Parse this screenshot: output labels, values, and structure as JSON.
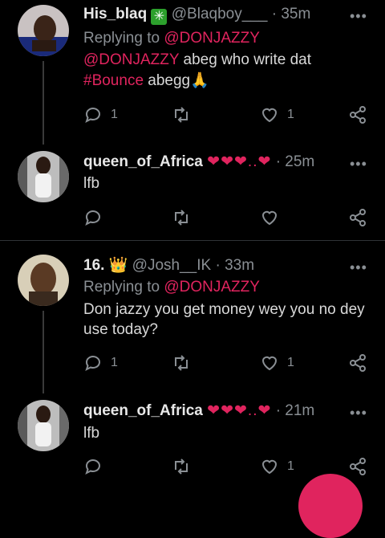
{
  "colors": {
    "accent": "#e0245e",
    "muted": "#8a8f94",
    "background": "#000000"
  },
  "tweets": [
    {
      "name": "His_blaq",
      "badge": "✳",
      "handle": "@Blaqboy___",
      "dot": "·",
      "time": "35m",
      "replying_label": "Replying to",
      "replying_to": "@DONJAZZY",
      "body_mention": "@DONJAZZY",
      "body_text1": " abeg who write dat",
      "hashtag": "#Bounce",
      "body_text2": " abegg🙏",
      "reply_count": "1",
      "retweet_count": "",
      "like_count": "1"
    },
    {
      "name": "queen_of_Africa",
      "hearts": "❤❤❤..❤",
      "dot": "·",
      "time": "25m",
      "body": "lfb",
      "reply_count": "",
      "retweet_count": "",
      "like_count": ""
    },
    {
      "name": "16.",
      "crown": "👑",
      "handle": "@Josh__IK",
      "dot": "·",
      "time": "33m",
      "replying_label": "Replying to",
      "replying_to": "@DONJAZZY",
      "body_line1": "Don jazzy you get money wey you no dey",
      "body_line2": "use today?",
      "reply_count": "1",
      "retweet_count": "",
      "like_count": "1"
    },
    {
      "name": "queen_of_Africa",
      "hearts": "❤❤❤..❤",
      "dot": "·",
      "time": "21m",
      "body": "lfb",
      "reply_count": "",
      "retweet_count": "",
      "like_count": "1"
    }
  ],
  "icons": {
    "reply": "reply-icon",
    "retweet": "retweet-icon",
    "like": "heart-icon",
    "share": "share-icon",
    "more": "more-icon"
  },
  "more_label": "•••"
}
